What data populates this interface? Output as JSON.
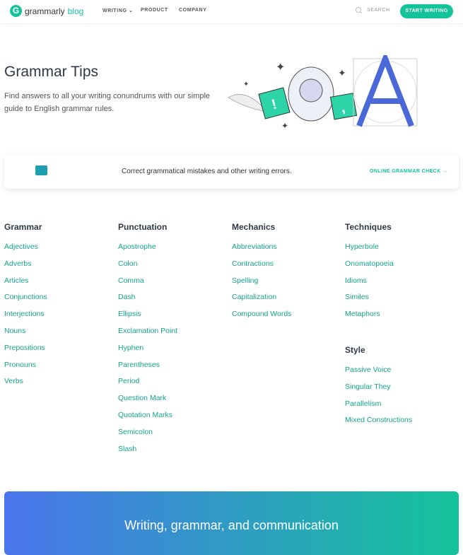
{
  "nav": {
    "logo_word": "grammarly",
    "logo_blog": "blog",
    "links": [
      "WRITING",
      "PRODUCT",
      "COMPANY"
    ],
    "search": "SEARCH",
    "cta": "START WRITING"
  },
  "hero": {
    "title": "Grammar Tips",
    "subtitle": "Find answers to all your writing conundrums with our simple guide to English grammar rules."
  },
  "card": {
    "text": "Correct grammatical mistakes and other writing errors.",
    "link": "ONLINE GRAMMAR CHECK →"
  },
  "columns": [
    {
      "title": "Grammar",
      "items": [
        "Adjectives",
        "Adverbs",
        "Articles",
        "Conjunctions",
        "Interjections",
        "Nouns",
        "Prepositions",
        "Pronouns",
        "Verbs"
      ]
    },
    {
      "title": "Punctuation",
      "items": [
        "Apostrophe",
        "Colon",
        "Comma",
        "Dash",
        "Ellipsis",
        "Exclamation Point",
        "Hyphen",
        "Parentheses",
        "Period",
        "Question Mark",
        "Quotation Marks",
        "Semicolon",
        "Slash"
      ]
    },
    {
      "title": "Mechanics",
      "items": [
        "Abbreviations",
        "Contractions",
        "Spelling",
        "Capitalization",
        "Compound Words"
      ]
    },
    {
      "title": "Techniques",
      "items": [
        "Hyperbole",
        "Onomatopoeia",
        "Idioms",
        "Similes",
        "Metaphors"
      ]
    },
    {
      "title": "Style",
      "items": [
        "Passive Voice",
        "Singular They",
        "Parallelism",
        "Mixed Constructions"
      ]
    }
  ],
  "banner": {
    "text": "Writing, grammar, and communication"
  },
  "colors": {
    "brand": "#15c39a",
    "link": "#15a38a"
  }
}
